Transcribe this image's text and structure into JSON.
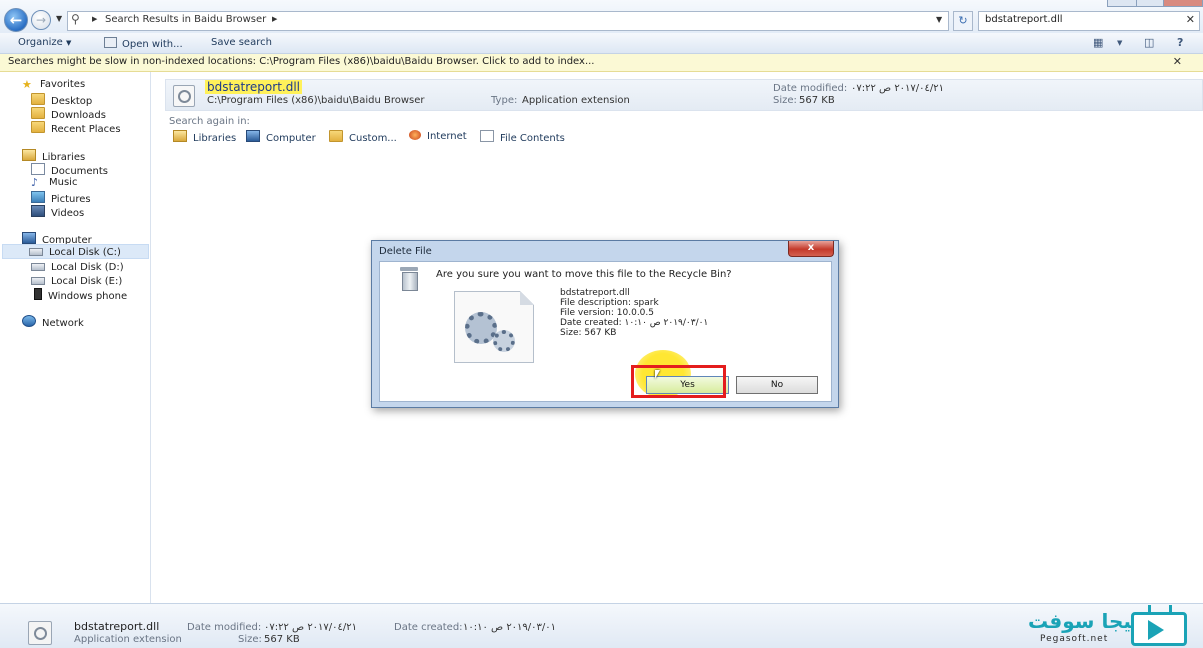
{
  "address_bar": {
    "location": "Search Results in Baidu Browser",
    "search_value": "bdstatreport.dll"
  },
  "toolbar": {
    "organize": "Organize",
    "open_with": "Open with...",
    "save_search": "Save search"
  },
  "info_bar": {
    "text": "Searches might be slow in non-indexed locations: C:\\Program Files (x86)\\baidu\\Baidu Browser. Click to add to index..."
  },
  "sidebar": {
    "favorites": "Favorites",
    "desktop": "Desktop",
    "downloads": "Downloads",
    "recent": "Recent Places",
    "libraries": "Libraries",
    "documents": "Documents",
    "music": "Music",
    "pictures": "Pictures",
    "videos": "Videos",
    "computer": "Computer",
    "disk_c": "Local Disk (C:)",
    "disk_d": "Local Disk (D:)",
    "disk_e": "Local Disk (E:)",
    "phone": "Windows phone",
    "network": "Network"
  },
  "result": {
    "name": "bdstatreport.dll",
    "path": "C:\\Program Files (x86)\\baidu\\Baidu Browser",
    "type_label": "Type:",
    "type_value": "Application extension",
    "modified_label": "Date modified:",
    "modified_value": "٢٠١٧/٠٤/٢١ ص ٠٧:٢٢",
    "size_label": "Size:",
    "size_value": "567 KB"
  },
  "search_again": {
    "label": "Search again in:",
    "libraries": "Libraries",
    "computer": "Computer",
    "custom": "Custom...",
    "internet": "Internet",
    "file_contents": "File Contents"
  },
  "dialog": {
    "title": "Delete File",
    "close": "x",
    "question": "Are you sure you want to move this file to the Recycle Bin?",
    "file_name": "bdstatreport.dll",
    "description": "File description: spark",
    "version": "File version: 10.0.0.5",
    "created": "Date created: ٢٠١٩/٠٣/٠١ ص ١٠:١٠",
    "size": "Size: 567 KB",
    "yes": "Yes",
    "no": "No"
  },
  "details": {
    "name": "bdstatreport.dll",
    "type": "Application extension",
    "modified_label": "Date modified:",
    "modified_value": "٢٠١٧/٠٤/٢١ ص ٠٧:٢٢",
    "created_label": "Date created:",
    "created_value": "٢٠١٩/٠٣/٠١ ص ١٠:١٠",
    "size_label": "Size:",
    "size_value": "567 KB"
  },
  "watermark": {
    "arabic": "بيجا سوفت",
    "url": "Pegasoft.net"
  },
  "colors": {
    "highlight": "#fff15a",
    "red_box": "#e41d1d",
    "brand": "#1aa3b6"
  }
}
